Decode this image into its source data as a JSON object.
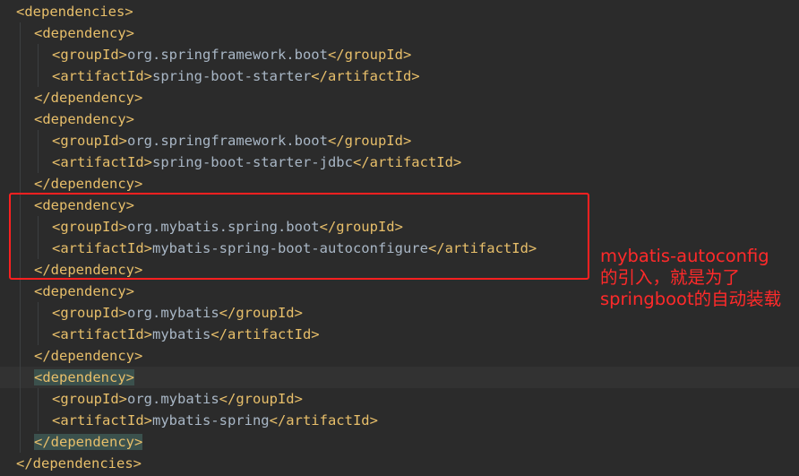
{
  "lines": [
    {
      "indent": 0,
      "parts": [
        [
          "tag",
          "<dependencies>"
        ]
      ]
    },
    {
      "indent": 1,
      "parts": [
        [
          "tag",
          "<dependency>"
        ]
      ]
    },
    {
      "indent": 2,
      "parts": [
        [
          "tag",
          "<groupId>"
        ],
        [
          "text",
          "org.springframework.boot"
        ],
        [
          "tag",
          "</groupId>"
        ]
      ]
    },
    {
      "indent": 2,
      "parts": [
        [
          "tag",
          "<artifactId>"
        ],
        [
          "text",
          "spring-boot-starter"
        ],
        [
          "tag",
          "</artifactId>"
        ]
      ]
    },
    {
      "indent": 1,
      "parts": [
        [
          "tag",
          "</dependency>"
        ]
      ]
    },
    {
      "indent": 1,
      "parts": [
        [
          "tag",
          "<dependency>"
        ]
      ]
    },
    {
      "indent": 2,
      "parts": [
        [
          "tag",
          "<groupId>"
        ],
        [
          "text",
          "org.springframework.boot"
        ],
        [
          "tag",
          "</groupId>"
        ]
      ]
    },
    {
      "indent": 2,
      "parts": [
        [
          "tag",
          "<artifactId>"
        ],
        [
          "text",
          "spring-boot-starter-jdbc"
        ],
        [
          "tag",
          "</artifactId>"
        ]
      ]
    },
    {
      "indent": 1,
      "parts": [
        [
          "tag",
          "</dependency>"
        ]
      ]
    },
    {
      "indent": 1,
      "parts": [
        [
          "tag",
          "<dependency>"
        ]
      ]
    },
    {
      "indent": 2,
      "parts": [
        [
          "tag",
          "<groupId>"
        ],
        [
          "text",
          "org.mybatis.spring.boot"
        ],
        [
          "tag",
          "</groupId>"
        ]
      ]
    },
    {
      "indent": 2,
      "parts": [
        [
          "tag",
          "<artifactId>"
        ],
        [
          "text",
          "mybatis-spring-boot-autoconfigure"
        ],
        [
          "tag",
          "</artifactId>"
        ]
      ]
    },
    {
      "indent": 1,
      "parts": [
        [
          "tag",
          "</dependency>"
        ]
      ]
    },
    {
      "indent": 1,
      "parts": [
        [
          "tag",
          "<dependency>"
        ]
      ]
    },
    {
      "indent": 2,
      "parts": [
        [
          "tag",
          "<groupId>"
        ],
        [
          "text",
          "org.mybatis"
        ],
        [
          "tag",
          "</groupId>"
        ]
      ]
    },
    {
      "indent": 2,
      "parts": [
        [
          "tag",
          "<artifactId>"
        ],
        [
          "text",
          "mybatis"
        ],
        [
          "tag",
          "</artifactId>"
        ]
      ]
    },
    {
      "indent": 1,
      "parts": [
        [
          "tag",
          "</dependency>"
        ]
      ]
    },
    {
      "indent": 1,
      "parts": [
        [
          "tag-match",
          "<dependency>"
        ]
      ],
      "current": true
    },
    {
      "indent": 2,
      "parts": [
        [
          "tag",
          "<groupId>"
        ],
        [
          "text",
          "org.mybatis"
        ],
        [
          "tag",
          "</groupId>"
        ]
      ]
    },
    {
      "indent": 2,
      "parts": [
        [
          "tag",
          "<artifactId>"
        ],
        [
          "text",
          "mybatis-spring"
        ],
        [
          "tag",
          "</artifactId>"
        ]
      ]
    },
    {
      "indent": 1,
      "parts": [
        [
          "tag-match",
          "</dependency>"
        ]
      ]
    },
    {
      "indent": 0,
      "parts": [
        [
          "tag",
          "</dependencies>"
        ]
      ]
    }
  ],
  "annotation": {
    "lines": [
      "mybatis-autoconfig",
      "的引入，就是为了",
      "springboot的自动装载"
    ],
    "color": "#ff2a2a"
  },
  "colors": {
    "background": "#2b2b2b",
    "tag": "#e8bf6a",
    "text": "#a9b7c6",
    "match_highlight": "#3b514d",
    "annotation_box": "#ff2020"
  }
}
